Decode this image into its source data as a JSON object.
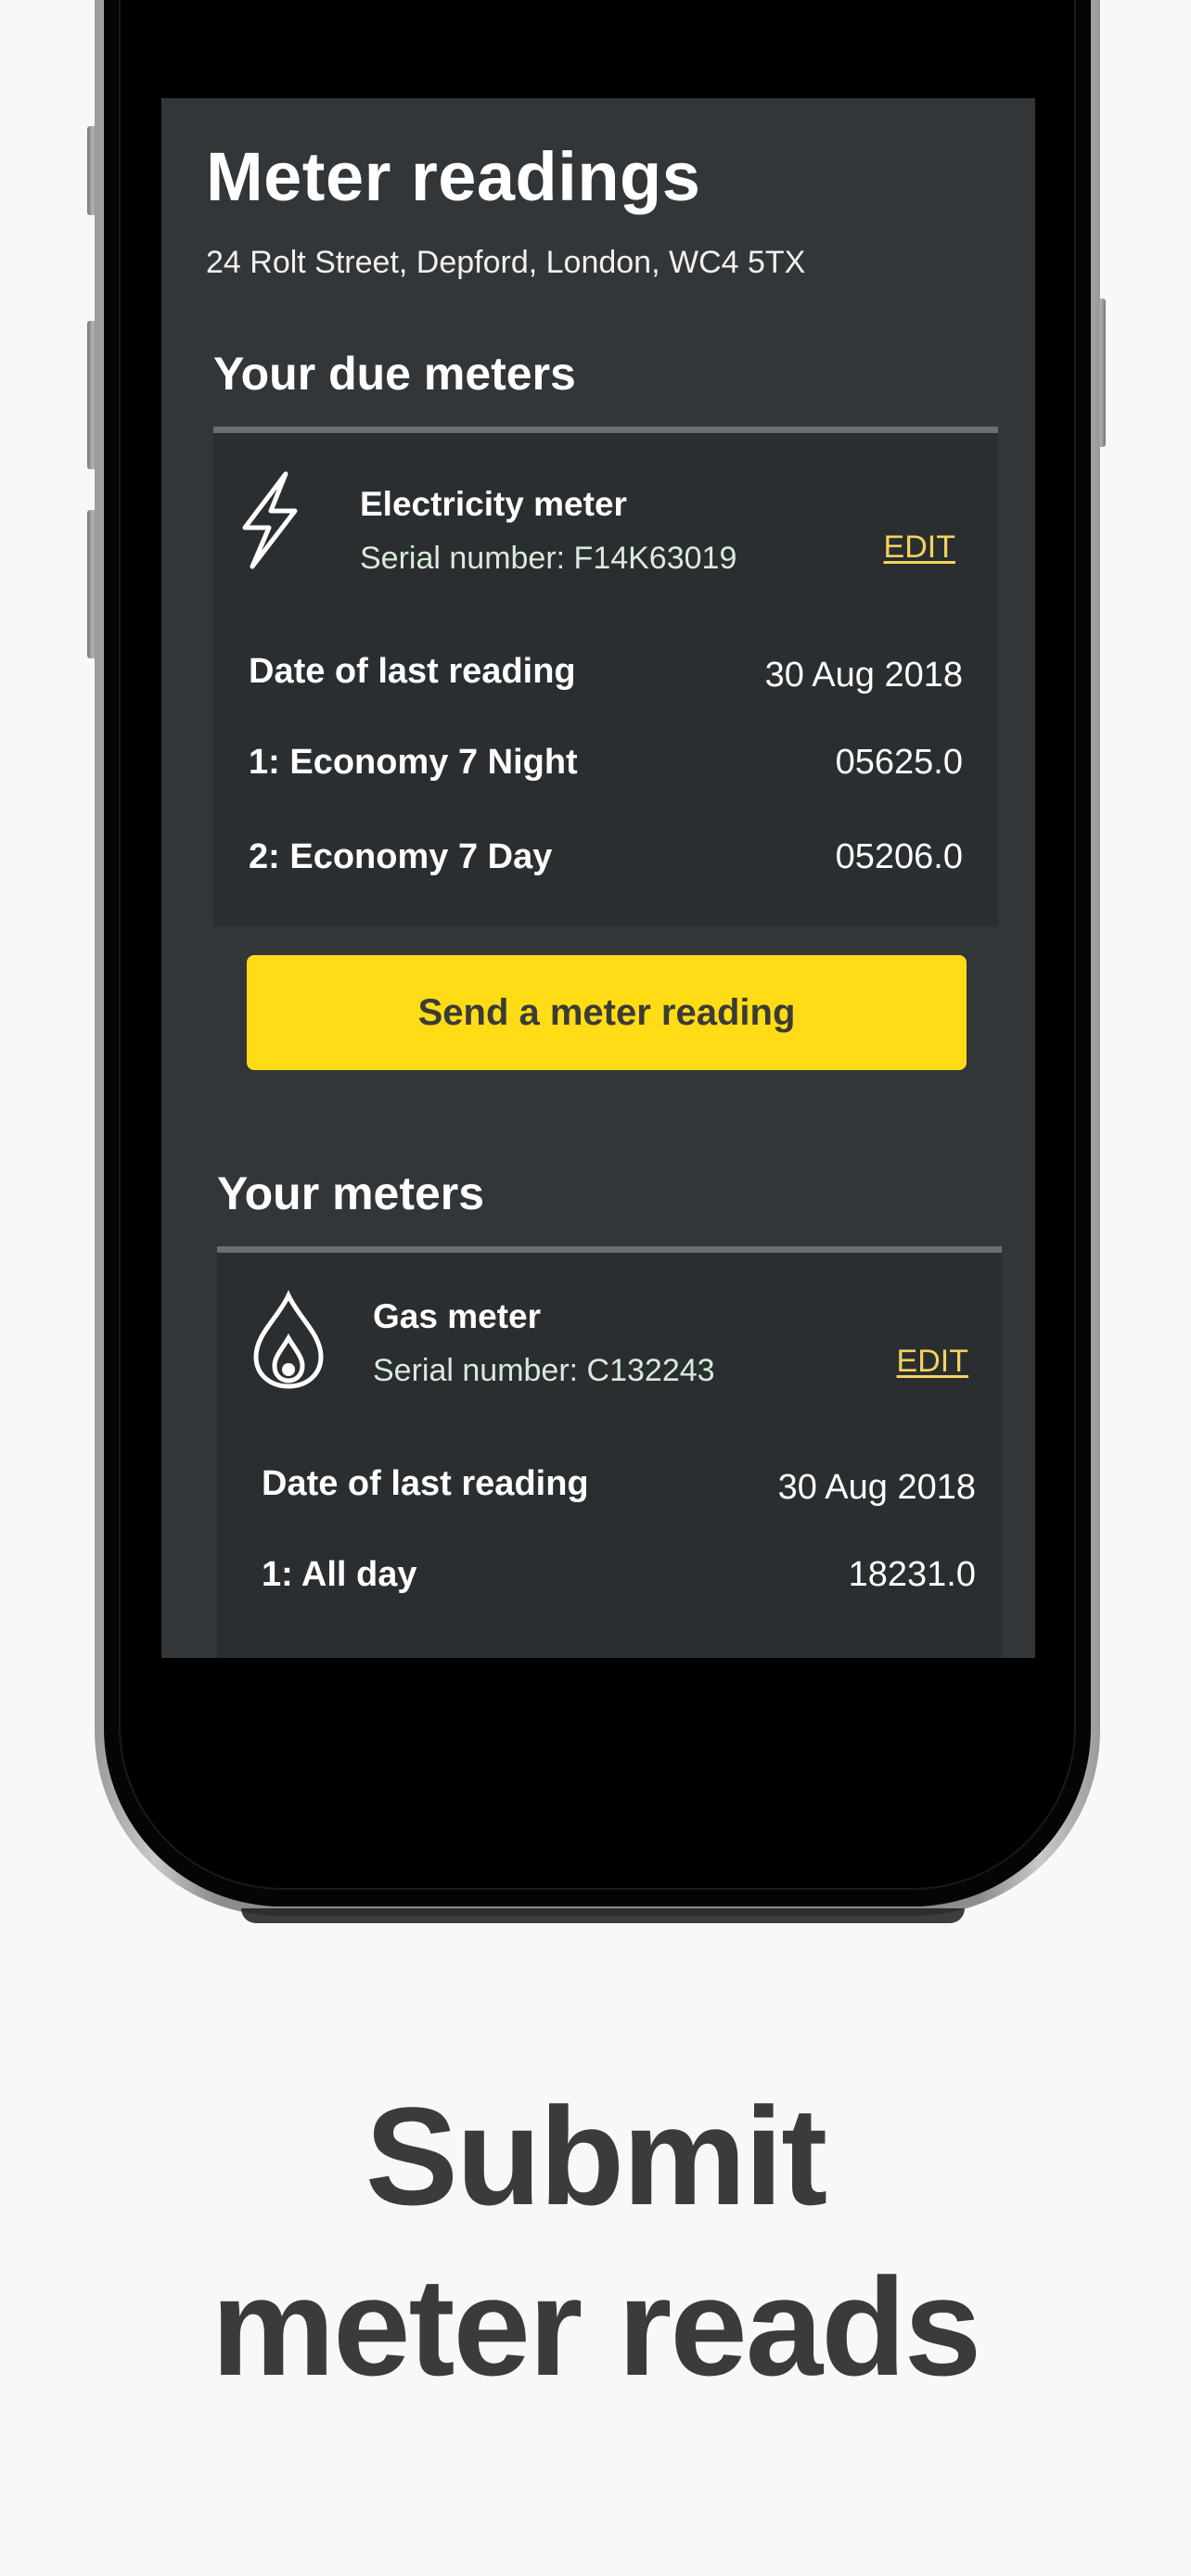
{
  "screen": {
    "title": "Meter readings",
    "address": "24 Rolt Street, Depford, London, WC4 5TX"
  },
  "due_meters": {
    "section_title": "Your due meters",
    "meter": {
      "icon": "lightning-bolt-icon",
      "name": "Electricity meter",
      "serial": "Serial number: F14K63019",
      "edit_label": "EDIT",
      "rows": [
        {
          "label": "Date of last reading",
          "value": "30 Aug 2018"
        },
        {
          "label": "1: Economy 7 Night",
          "value": "05625.0"
        },
        {
          "label": "2: Economy 7 Day",
          "value": "05206.0"
        }
      ],
      "button_label": "Send a meter reading"
    }
  },
  "your_meters": {
    "section_title": "Your meters",
    "meter": {
      "icon": "gas-flame-icon",
      "name": "Gas meter",
      "serial": "Serial number: C132243",
      "edit_label": "EDIT",
      "rows": [
        {
          "label": "Date of last reading",
          "value": "30 Aug 2018"
        },
        {
          "label": "1: All day",
          "value": "18231.0"
        }
      ]
    }
  },
  "headline": {
    "line1": "Submit",
    "line2": "meter reads"
  },
  "colors": {
    "accent_yellow": "#ffdc16",
    "edit_link": "#f4d35e",
    "screen_bg": "#323638",
    "card_bg": "#2a2e30",
    "headline_text": "#3d3a3a"
  }
}
